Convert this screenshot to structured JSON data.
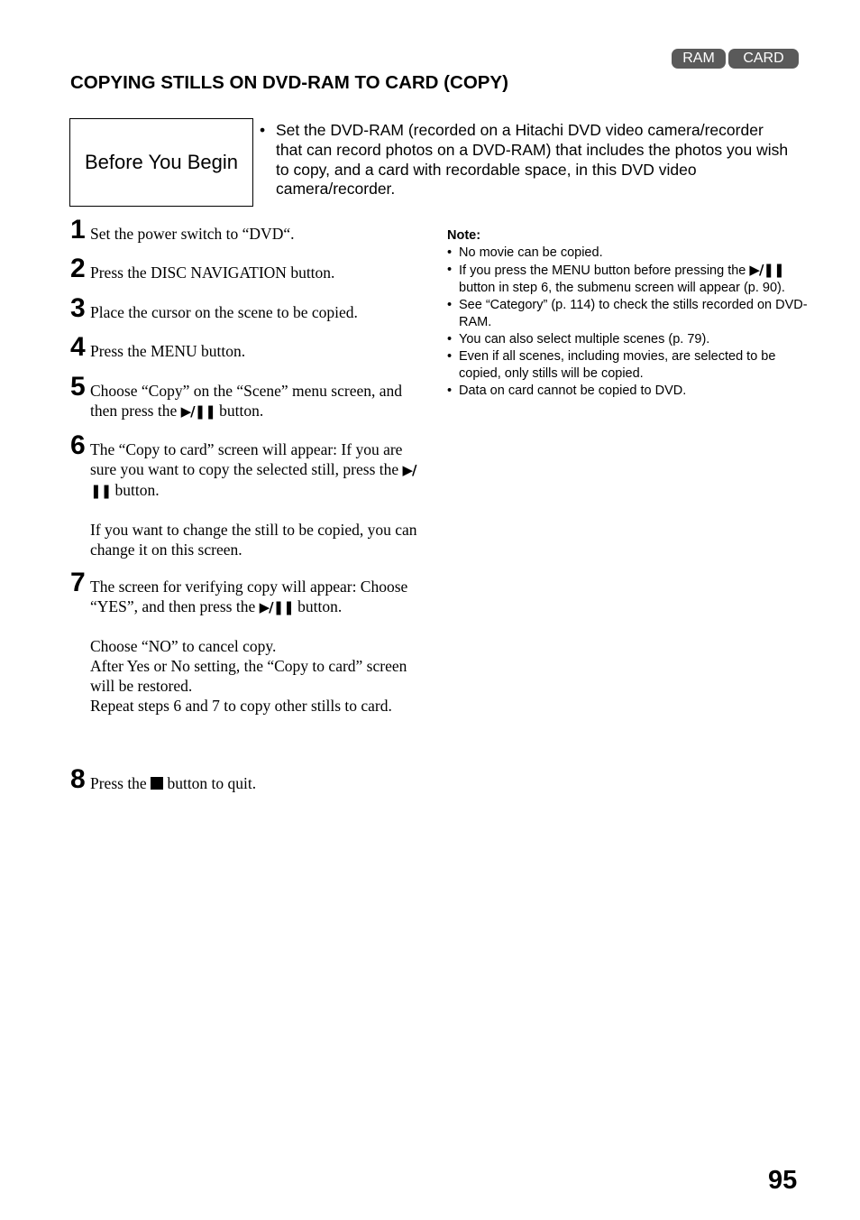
{
  "badges": [
    "RAM",
    "CARD"
  ],
  "title": "COPYING STILLS ON DVD-RAM TO CARD (COPY)",
  "before_you_begin": {
    "label": "Before You Begin",
    "text": "Set the DVD-RAM (recorded on a Hitachi DVD video camera/recorder that can record photos on a DVD-RAM) that includes the photos you wish to copy, and a card with recordable space, in this DVD video camera/recorder."
  },
  "icons": {
    "play_pause": "▶/❚❚",
    "bullet": "•"
  },
  "steps": [
    {
      "num": "1",
      "text": "Set the power switch to “DVD“."
    },
    {
      "num": "2",
      "text": "Press the DISC NAVIGATION button."
    },
    {
      "num": "3",
      "text": "Place the cursor on the scene to be copied."
    },
    {
      "num": "4",
      "text": "Press the MENU button."
    },
    {
      "num": "5",
      "text_before": "Choose “Copy” on the “Scene” menu screen, and then press the",
      "text_after": "button."
    },
    {
      "num": "6",
      "text_before": "The “Copy to card” screen will appear: If you are sure you want to copy the selected still, press the",
      "text_after": "button.",
      "extra": "If you want to change the still to be copied, you can change it on this screen."
    },
    {
      "num": "7",
      "text_before": "The screen for verifying copy will appear: Choose “YES”, and then press the",
      "text_after": "button.",
      "extra_lines": [
        "Choose “NO” to cancel copy.",
        "After Yes or No setting, the “Copy to card” screen will be restored.",
        "Repeat steps 6 and 7 to copy other stills to card."
      ]
    },
    {
      "num": "8",
      "text_before": "Press the",
      "text_after": "button to quit."
    }
  ],
  "note": {
    "heading": "Note:",
    "items": [
      {
        "text": "No movie can be copied."
      },
      {
        "text_before": "If you press the MENU button before pressing the",
        "text_after": "button in step 6, the submenu screen will appear (p. 90)."
      },
      {
        "text": "See “Category” (p. 114) to check the stills recorded on DVD-RAM."
      },
      {
        "text": "You can also select multiple scenes (p. 79)."
      },
      {
        "text": "Even if all scenes, including movies, are selected to be copied, only stills will be copied."
      },
      {
        "text": "Data on card cannot be copied to DVD."
      }
    ]
  },
  "page_number": "95"
}
